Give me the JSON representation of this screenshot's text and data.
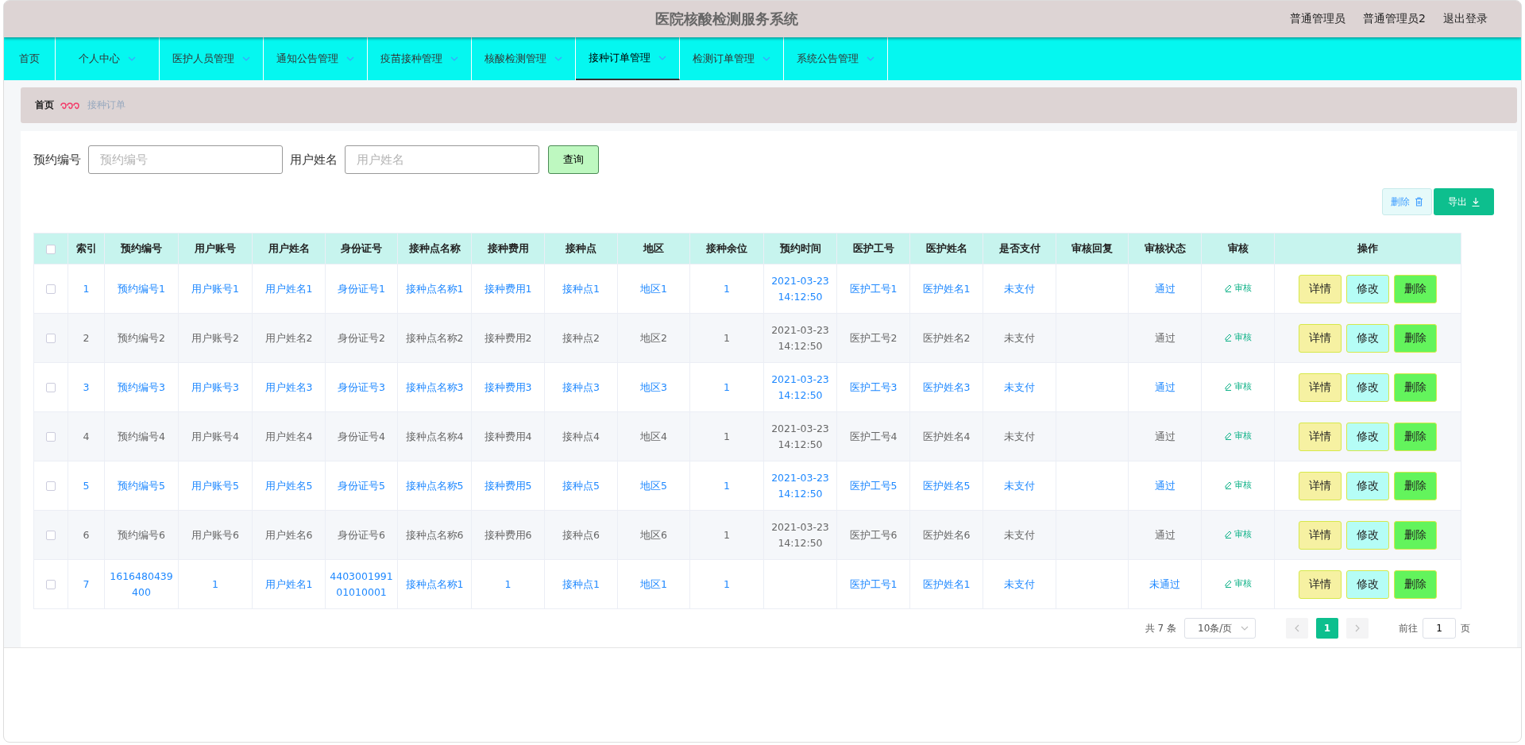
{
  "header": {
    "title": "医院核酸检测服务系统",
    "user_role": "普通管理员",
    "user_name": "普通管理员2",
    "logout": "退出登录"
  },
  "nav": [
    {
      "label": "首页",
      "selected": false,
      "dropdown": false
    },
    {
      "label": "个人中心",
      "selected": false,
      "dropdown": true
    },
    {
      "label": "医护人员管理",
      "selected": false,
      "dropdown": true
    },
    {
      "label": "通知公告管理",
      "selected": false,
      "dropdown": true
    },
    {
      "label": "疫苗接种管理",
      "selected": false,
      "dropdown": true
    },
    {
      "label": "核酸检测管理",
      "selected": false,
      "dropdown": true
    },
    {
      "label": "接种订单管理",
      "selected": true,
      "dropdown": true
    },
    {
      "label": "检测订单管理",
      "selected": false,
      "dropdown": true
    },
    {
      "label": "系统公告管理",
      "selected": false,
      "dropdown": true
    }
  ],
  "breadcrumb": [
    {
      "label": "首页",
      "kind": "home"
    },
    {
      "label": "接种订单",
      "kind": "current"
    }
  ],
  "search": {
    "fields": [
      {
        "label": "预约编号",
        "placeholder": "预约编号"
      },
      {
        "label": "用户姓名",
        "placeholder": "用户姓名"
      }
    ],
    "button": "查询"
  },
  "toolbar": {
    "delete": "删除",
    "export": "导出"
  },
  "table": {
    "select_all_checked": false,
    "columns": [
      "索引",
      "预约编号",
      "用户账号",
      "用户姓名",
      "身份证号",
      "接种点名称",
      "接种费用",
      "接种点",
      "地区",
      "接种余位",
      "预约时间",
      "医护工号",
      "医护姓名",
      "是否支付",
      "审核回复",
      "审核状态",
      "审核",
      "操作"
    ],
    "rows": [
      {
        "kind": "link",
        "checked": false,
        "index": "1",
        "booking_no": "预约编号1",
        "account": "用户账号1",
        "name": "用户姓名1",
        "id_no": "身份证号1",
        "site_name": "接种点名称1",
        "fee": "接种费用1",
        "site": "接种点1",
        "region": "地区1",
        "remaining": "1",
        "time": "2021-03-23 14:12:50",
        "staff_no": "医护工号1",
        "staff_name": "医护姓名1",
        "paid": "未支付",
        "status": "通过",
        "audit": "审核",
        "actions": [
          {
            "label": "详情",
            "kind": "detail"
          },
          {
            "label": "修改",
            "kind": "edit"
          },
          {
            "label": "删除",
            "kind": "delete"
          }
        ]
      },
      {
        "kind": "plain",
        "checked": false,
        "index": "2",
        "booking_no": "预约编号2",
        "account": "用户账号2",
        "name": "用户姓名2",
        "id_no": "身份证号2",
        "site_name": "接种点名称2",
        "fee": "接种费用2",
        "site": "接种点2",
        "region": "地区2",
        "remaining": "1",
        "time": "2021-03-23 14:12:50",
        "staff_no": "医护工号2",
        "staff_name": "医护姓名2",
        "paid": "未支付",
        "status": "通过",
        "audit": "审核",
        "actions": [
          {
            "label": "详情",
            "kind": "detail"
          },
          {
            "label": "修改",
            "kind": "edit"
          },
          {
            "label": "删除",
            "kind": "delete"
          }
        ]
      },
      {
        "kind": "link",
        "checked": false,
        "index": "3",
        "booking_no": "预约编号3",
        "account": "用户账号3",
        "name": "用户姓名3",
        "id_no": "身份证号3",
        "site_name": "接种点名称3",
        "fee": "接种费用3",
        "site": "接种点3",
        "region": "地区3",
        "remaining": "1",
        "time": "2021-03-23 14:12:50",
        "staff_no": "医护工号3",
        "staff_name": "医护姓名3",
        "paid": "未支付",
        "status": "通过",
        "audit": "审核",
        "actions": [
          {
            "label": "详情",
            "kind": "detail"
          },
          {
            "label": "修改",
            "kind": "edit"
          },
          {
            "label": "删除",
            "kind": "delete"
          }
        ]
      },
      {
        "kind": "plain",
        "checked": false,
        "index": "4",
        "booking_no": "预约编号4",
        "account": "用户账号4",
        "name": "用户姓名4",
        "id_no": "身份证号4",
        "site_name": "接种点名称4",
        "fee": "接种费用4",
        "site": "接种点4",
        "region": "地区4",
        "remaining": "1",
        "time": "2021-03-23 14:12:50",
        "staff_no": "医护工号4",
        "staff_name": "医护姓名4",
        "paid": "未支付",
        "status": "通过",
        "audit": "审核",
        "actions": [
          {
            "label": "详情",
            "kind": "detail"
          },
          {
            "label": "修改",
            "kind": "edit"
          },
          {
            "label": "删除",
            "kind": "delete"
          }
        ]
      },
      {
        "kind": "link",
        "checked": false,
        "index": "5",
        "booking_no": "预约编号5",
        "account": "用户账号5",
        "name": "用户姓名5",
        "id_no": "身份证号5",
        "site_name": "接种点名称5",
        "fee": "接种费用5",
        "site": "接种点5",
        "region": "地区5",
        "remaining": "1",
        "time": "2021-03-23 14:12:50",
        "staff_no": "医护工号5",
        "staff_name": "医护姓名5",
        "paid": "未支付",
        "status": "通过",
        "audit": "审核",
        "actions": [
          {
            "label": "详情",
            "kind": "detail"
          },
          {
            "label": "修改",
            "kind": "edit"
          },
          {
            "label": "删除",
            "kind": "delete"
          }
        ]
      },
      {
        "kind": "plain",
        "checked": false,
        "index": "6",
        "booking_no": "预约编号6",
        "account": "用户账号6",
        "name": "用户姓名6",
        "id_no": "身份证号6",
        "site_name": "接种点名称6",
        "fee": "接种费用6",
        "site": "接种点6",
        "region": "地区6",
        "remaining": "1",
        "time": "2021-03-23 14:12:50",
        "staff_no": "医护工号6",
        "staff_name": "医护姓名6",
        "paid": "未支付",
        "status": "通过",
        "audit": "审核",
        "actions": [
          {
            "label": "详情",
            "kind": "detail"
          },
          {
            "label": "修改",
            "kind": "edit"
          },
          {
            "label": "删除",
            "kind": "delete"
          }
        ]
      },
      {
        "kind": "link",
        "checked": false,
        "index": "7",
        "booking_no": "1616480439400",
        "account": "1",
        "name": "用户姓名1",
        "id_no": "440300199101010001",
        "site_name": "接种点名称1",
        "fee": "1",
        "site": "接种点1",
        "region": "地区1",
        "remaining": "1",
        "staff_no": "医护工号1",
        "staff_name": "医护姓名1",
        "paid": "未支付",
        "status": "未通过",
        "audit": "审核",
        "actions": [
          {
            "label": "详情",
            "kind": "detail"
          },
          {
            "label": "修改",
            "kind": "edit"
          },
          {
            "label": "删除",
            "kind": "delete"
          }
        ]
      }
    ]
  },
  "pagination": {
    "total": "共 7 条",
    "page_size": "10条/页",
    "pages": [
      {
        "label": "1",
        "selected": true
      }
    ],
    "goto_label": "前往",
    "goto_value": "1",
    "page_suffix": "页"
  }
}
